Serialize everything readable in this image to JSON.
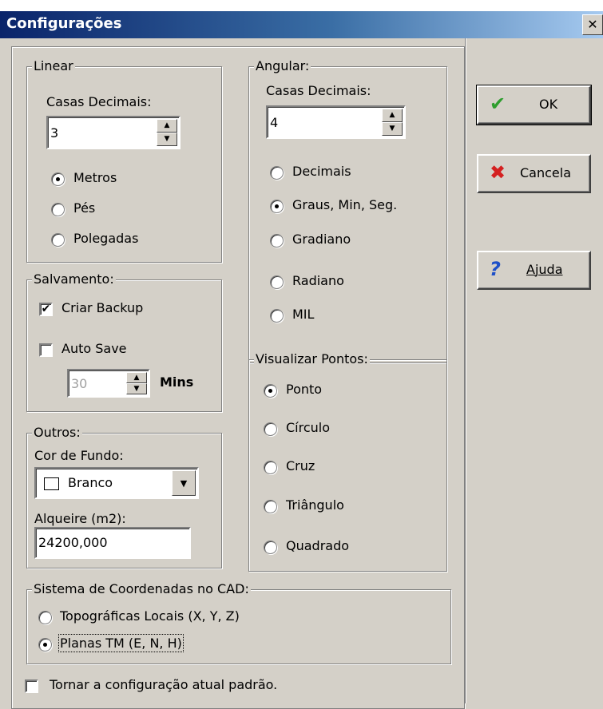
{
  "window": {
    "title": "Configurações",
    "close_glyph": "✕"
  },
  "linear": {
    "legend": "Linear",
    "decimals_label": "Casas Decimais:",
    "decimals_value": "3",
    "units": [
      {
        "label": "Metros",
        "selected": true
      },
      {
        "label": "Pés",
        "selected": false
      },
      {
        "label": "Polegadas",
        "selected": false
      }
    ]
  },
  "angular": {
    "legend": "Angular:",
    "decimals_label": "Casas Decimais:",
    "decimals_value": "4",
    "units": [
      {
        "label": "Decimais",
        "selected": false
      },
      {
        "label": "Graus, Min, Seg.",
        "selected": true
      },
      {
        "label": "Gradiano",
        "selected": false
      },
      {
        "label": "Radiano",
        "selected": false
      },
      {
        "label": "MIL",
        "selected": false
      }
    ]
  },
  "salvamento": {
    "legend": "Salvamento:",
    "backup_label": "Criar Backup",
    "backup_checked": true,
    "autosave_label": "Auto Save",
    "autosave_checked": false,
    "autosave_value": "30",
    "mins_label": "Mins"
  },
  "outros": {
    "legend": "Outros:",
    "bg_color_label": "Cor de Fundo:",
    "bg_color_value": "Branco",
    "alqueire_label": "Alqueire (m2):",
    "alqueire_value": "24200,000"
  },
  "points": {
    "legend": "Visualizar Pontos:",
    "options": [
      {
        "label": "Ponto",
        "selected": true
      },
      {
        "label": "Círculo",
        "selected": false
      },
      {
        "label": "Cruz",
        "selected": false
      },
      {
        "label": "Triângulo",
        "selected": false
      },
      {
        "label": "Quadrado",
        "selected": false
      }
    ]
  },
  "coords": {
    "legend": "Sistema de Coordenadas no CAD:",
    "options": [
      {
        "label": "Topográficas Locais (X, Y, Z)",
        "selected": false
      },
      {
        "label": "Planas TM (E, N, H)",
        "selected": true
      }
    ]
  },
  "default_checkbox": {
    "label": "Tornar a configuração atual padrão.",
    "checked": false
  },
  "buttons": {
    "ok": "OK",
    "cancel": "Cancela",
    "help": "Ajuda"
  },
  "colors": {
    "title_start": "#0a246a",
    "title_end": "#a6caf0",
    "face": "#d4d0c8",
    "ok_icon": "#2e9e2e",
    "cancel_icon": "#d42020",
    "help_icon": "#1e50c8"
  },
  "icons": {
    "ok": "checkmark-icon",
    "cancel": "x-icon",
    "help": "question-icon"
  }
}
